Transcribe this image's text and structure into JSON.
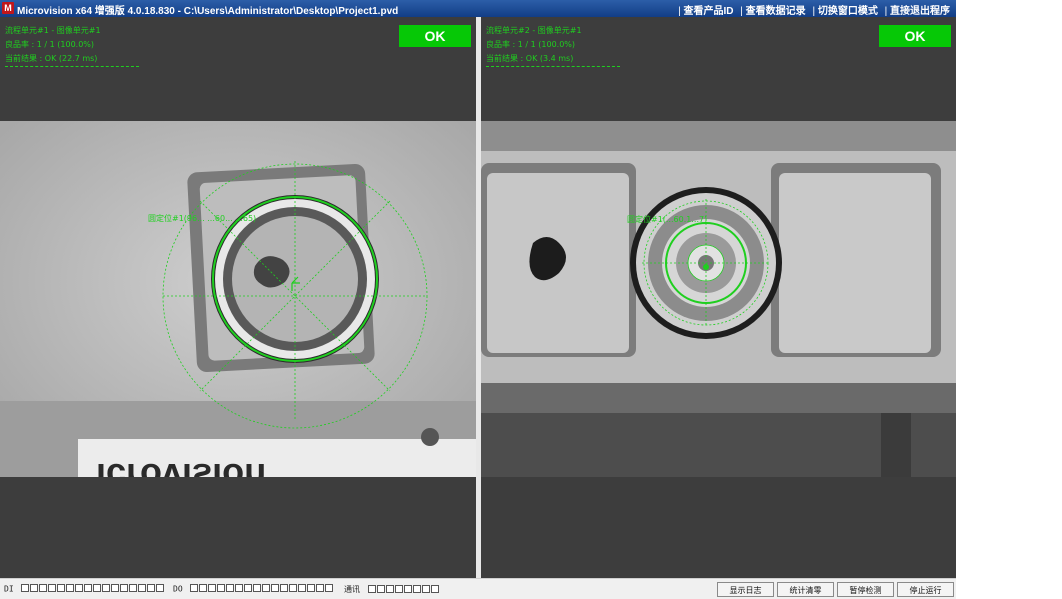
{
  "titlebar": {
    "title": "Microvision x64 增强版 4.0.18.830 - C:\\Users\\Administrator\\Desktop\\Project1.pvd",
    "menu": [
      "查看产品ID",
      "查看数据记录",
      "切换窗口模式",
      "直接退出程序"
    ]
  },
  "panels": [
    {
      "line1": "流程单元#1 - 图像单元#1",
      "line2": "良品率 : 1 / 1 (100.0%)",
      "line3": "当前结果 : OK (22.7 ms)",
      "status": "OK",
      "overlay_label": "圆定位#1(96... ...60... ...65)"
    },
    {
      "line1": "流程单元#2 - 图像单元#1",
      "line2": "良品率 : 1 / 1 (100.0%)",
      "line3": "当前结果 : OK (3.4 ms)",
      "status": "OK",
      "overlay_label": "圆定位#1(...60.1...7)"
    }
  ],
  "statusbar": {
    "di_label": "DI",
    "do_label": "DO",
    "comm_label": "通讯",
    "di_count": 16,
    "do_count": 16,
    "comm_count": 8,
    "buttons": [
      "显示日志",
      "统计清零",
      "暂停检测",
      "停止运行"
    ]
  },
  "colors": {
    "ok_green": "#06c806",
    "overlay_green": "#1fcf1f",
    "titlebar_blue": "#1e4c98"
  }
}
